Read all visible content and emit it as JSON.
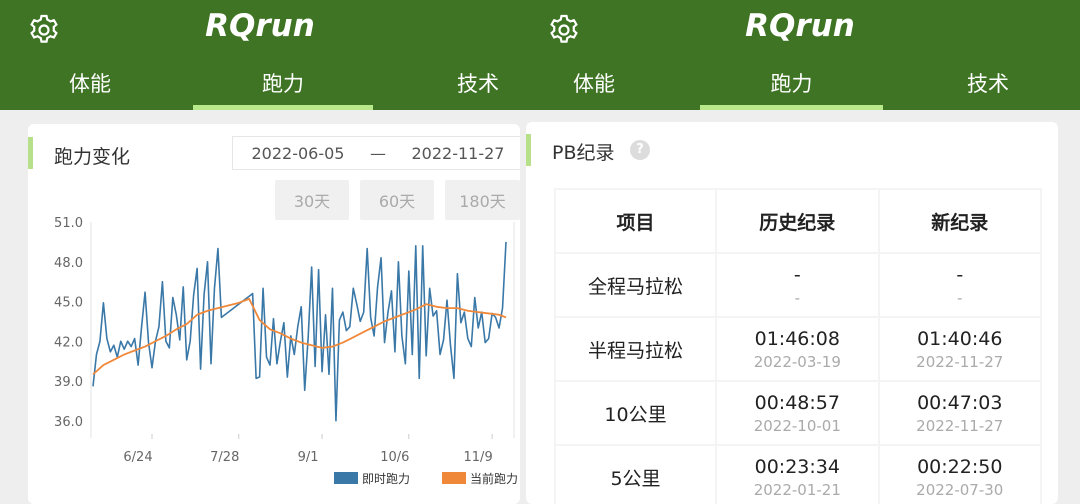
{
  "left": {
    "app_title": "RQrun",
    "tabs": [
      {
        "label": "体能"
      },
      {
        "label": "跑力"
      },
      {
        "label": "技术"
      }
    ],
    "active_tab": "跑力",
    "card_title": "跑力变化",
    "date_start": "2022-06-05",
    "date_sep": "—",
    "date_end": "2022-11-27",
    "range_buttons": [
      {
        "label": "30天"
      },
      {
        "label": "60天"
      },
      {
        "label": "180天"
      }
    ]
  },
  "right": {
    "app_title": "RQrun",
    "tabs": [
      {
        "label": "体能"
      },
      {
        "label": "跑力"
      },
      {
        "label": "技术"
      }
    ],
    "active_tab": "跑力",
    "card_title": "PB纪录",
    "help_symbol": "?",
    "table": {
      "headers": [
        "项目",
        "历史纪录",
        "新纪录"
      ],
      "rows": [
        {
          "event": "全程马拉松",
          "hist_time": "-",
          "hist_date": "-",
          "new_time": "-",
          "new_date": "-"
        },
        {
          "event": "半程马拉松",
          "hist_time": "01:46:08",
          "hist_date": "2022-03-19",
          "new_time": "01:40:46",
          "new_date": "2022-11-27"
        },
        {
          "event": "10公里",
          "hist_time": "00:48:57",
          "hist_date": "2022-10-01",
          "new_time": "00:47:03",
          "new_date": "2022-11-27"
        },
        {
          "event": "5公里",
          "hist_time": "00:23:34",
          "hist_date": "2022-01-21",
          "new_time": "00:22:50",
          "new_date": "2022-07-30"
        }
      ]
    }
  },
  "colors": {
    "header_green": "#3e7424",
    "tab_underline": "#b9e88a",
    "series_instant": "#3a78a8",
    "series_current": "#f0883a"
  },
  "chart_data": {
    "type": "line",
    "title": "",
    "xlabel": "",
    "ylabel": "",
    "ylim": [
      35,
      51
    ],
    "yticks": [
      "51.0",
      "48.0",
      "45.0",
      "42.0",
      "39.0",
      "36.0"
    ],
    "xticks": [
      "6/24",
      "7/28",
      "9/1",
      "10/6",
      "11/9"
    ],
    "legend": "bottom-right",
    "series": [
      {
        "name": "即时跑力",
        "color": "#3a78a8",
        "x": [
          0,
          1,
          2,
          3,
          4,
          5,
          6,
          7,
          8,
          9,
          10,
          11,
          12,
          13,
          14,
          15,
          16,
          17,
          18,
          19,
          20,
          21,
          22,
          23,
          24,
          25,
          26,
          27,
          28,
          29,
          30,
          31,
          32,
          33,
          34,
          35,
          36,
          37,
          38,
          39,
          40,
          41,
          42,
          43,
          44,
          45,
          46,
          47,
          48,
          49,
          50,
          51,
          52,
          53,
          54,
          55,
          56,
          57,
          58,
          59,
          60,
          61,
          62,
          63,
          64,
          65,
          66,
          67,
          68,
          69,
          70,
          71,
          72,
          73,
          74,
          75,
          76,
          77,
          78,
          79,
          80,
          81,
          82,
          83,
          84,
          85,
          86,
          87,
          88,
          89,
          90,
          91,
          92,
          93,
          94,
          95,
          96,
          97,
          98,
          99,
          100,
          101,
          102,
          103,
          104,
          105,
          106,
          107,
          108,
          109,
          110,
          111,
          112,
          113,
          114,
          115,
          116,
          117,
          118,
          119
        ],
        "values": [
          38.6,
          41.0,
          42.0,
          44.9,
          42.2,
          41.2,
          41.7,
          40.8,
          42.0,
          41.4,
          42.0,
          41.6,
          42.2,
          40.2,
          43.1,
          45.7,
          41.9,
          40.0,
          42.0,
          43.1,
          46.5,
          42.0,
          41.5,
          45.3,
          44.0,
          42.1,
          46.1,
          40.6,
          42.0,
          45.5,
          47.5,
          39.9,
          45.5,
          48.0,
          40.3,
          46.0,
          49.0,
          43.8,
          44.0,
          44.2,
          44.4,
          44.6,
          44.8,
          45.0,
          45.2,
          45.4,
          45.6,
          39.2,
          39.3,
          46.0,
          40.8,
          40.2,
          43.7,
          40.3,
          42.0,
          43.4,
          39.3,
          42.4,
          41.0,
          43.1,
          44.6,
          38.3,
          42.3,
          47.6,
          40.1,
          47.4,
          39.7,
          44.0,
          39.5,
          46.0,
          36.0,
          43.6,
          44.2,
          42.8,
          43.1,
          46.0,
          44.8,
          43.5,
          44.2,
          49.0,
          43.8,
          42.4,
          46.1,
          48.3,
          41.9,
          44.2,
          45.8,
          41.2,
          48.0,
          42.4,
          40.3,
          47.3,
          41.0,
          49.2,
          39.2,
          49.2,
          40.9,
          46.0,
          43.9,
          44.3,
          41.0,
          42.1,
          45.1,
          41.7,
          39.2,
          47.1,
          43.4,
          44.2,
          42.2,
          41.6,
          45.3,
          43.0,
          44.2,
          41.9,
          42.2,
          44.1,
          43.8,
          43.0,
          44.5,
          49.5
        ]
      },
      {
        "name": "当前跑力",
        "color": "#f0883a",
        "x": [
          0,
          3,
          6,
          9,
          12,
          15,
          18,
          21,
          24,
          27,
          30,
          33,
          36,
          39,
          42,
          45,
          48,
          51,
          54,
          57,
          60,
          63,
          66,
          69,
          72,
          75,
          78,
          81,
          84,
          87,
          90,
          93,
          96,
          99,
          102,
          105,
          108,
          111,
          114,
          117,
          119
        ],
        "values": [
          39.5,
          40.2,
          40.6,
          41.0,
          41.3,
          41.6,
          42.0,
          42.4,
          42.9,
          43.3,
          44.0,
          44.3,
          44.5,
          44.7,
          44.9,
          45.2,
          43.6,
          42.9,
          42.6,
          42.2,
          41.9,
          41.7,
          41.5,
          41.6,
          41.9,
          42.3,
          42.7,
          43.1,
          43.5,
          43.8,
          44.1,
          44.4,
          44.8,
          44.6,
          44.5,
          44.5,
          44.3,
          44.2,
          44.1,
          44.0,
          43.8
        ]
      }
    ]
  }
}
